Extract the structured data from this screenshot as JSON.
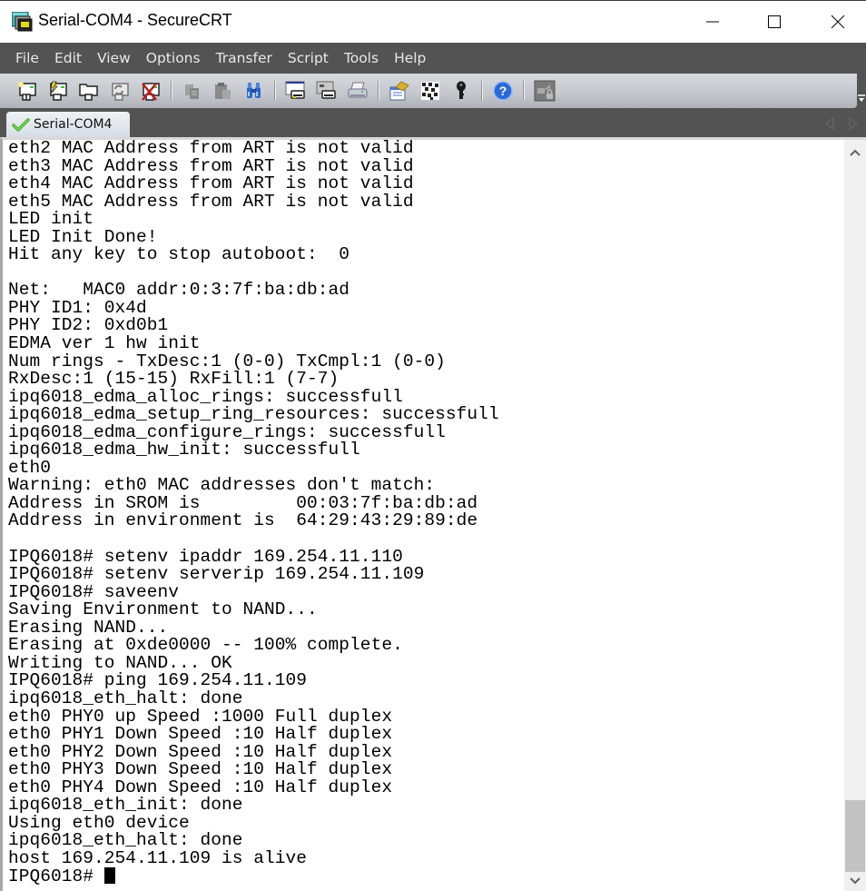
{
  "window": {
    "title": "Serial-COM4 - SecureCRT",
    "controls": {
      "minimize": "minimize",
      "maximize": "maximize",
      "close": "close"
    }
  },
  "menu": {
    "items": [
      {
        "label": "File"
      },
      {
        "label": "Edit"
      },
      {
        "label": "View"
      },
      {
        "label": "Options"
      },
      {
        "label": "Transfer"
      },
      {
        "label": "Script"
      },
      {
        "label": "Tools"
      },
      {
        "label": "Help"
      }
    ]
  },
  "toolbar": {
    "buttons": [
      {
        "icon": "connect-icon",
        "tooltip": "Connect"
      },
      {
        "icon": "quick-connect-icon",
        "tooltip": "Quick Connect"
      },
      {
        "icon": "connect-in-tab-icon",
        "tooltip": "Connect in Tab"
      },
      {
        "icon": "reconnect-icon",
        "tooltip": "Reconnect"
      },
      {
        "icon": "disconnect-icon",
        "tooltip": "Disconnect"
      },
      {
        "icon": "copy-icon",
        "tooltip": "Copy"
      },
      {
        "icon": "paste-icon",
        "tooltip": "Paste"
      },
      {
        "icon": "find-icon",
        "tooltip": "Find"
      },
      {
        "icon": "print-screen-icon",
        "tooltip": "Print Screen"
      },
      {
        "icon": "print-selection-icon",
        "tooltip": "Print Selection"
      },
      {
        "icon": "print-icon",
        "tooltip": "Print"
      },
      {
        "icon": "session-options-icon",
        "tooltip": "Session Options"
      },
      {
        "icon": "keymap-icon",
        "tooltip": "Keymap Editor"
      },
      {
        "icon": "key-icon",
        "tooltip": "Public Key Assistant"
      },
      {
        "icon": "help-icon",
        "tooltip": "Help"
      },
      {
        "icon": "sftp-icon",
        "tooltip": "SecureFX"
      }
    ]
  },
  "tabs": [
    {
      "label": "Serial-COM4",
      "status": "connected",
      "status_color": "#4caf2a"
    }
  ],
  "terminal": {
    "lines": [
      "eth2 MAC Address from ART is not valid",
      "eth3 MAC Address from ART is not valid",
      "eth4 MAC Address from ART is not valid",
      "eth5 MAC Address from ART is not valid",
      "LED init",
      "LED Init Done!",
      "Hit any key to stop autoboot:  0",
      "",
      "Net:   MAC0 addr:0:3:7f:ba:db:ad",
      "PHY ID1: 0x4d",
      "PHY ID2: 0xd0b1",
      "EDMA ver 1 hw init",
      "Num rings - TxDesc:1 (0-0) TxCmpl:1 (0-0)",
      "RxDesc:1 (15-15) RxFill:1 (7-7)",
      "ipq6018_edma_alloc_rings: successfull",
      "ipq6018_edma_setup_ring_resources: successfull",
      "ipq6018_edma_configure_rings: successfull",
      "ipq6018_edma_hw_init: successfull",
      "eth0",
      "Warning: eth0 MAC addresses don't match:",
      "Address in SROM is         00:03:7f:ba:db:ad",
      "Address in environment is  64:29:43:29:89:de",
      "",
      "IPQ6018# setenv ipaddr 169.254.11.110",
      "IPQ6018# setenv serverip 169.254.11.109",
      "IPQ6018# saveenv",
      "Saving Environment to NAND...",
      "Erasing NAND...",
      "Erasing at 0xde0000 -- 100% complete.",
      "Writing to NAND... OK",
      "IPQ6018# ping 169.254.11.109",
      "ipq6018_eth_halt: done",
      "eth0 PHY0 up Speed :1000 Full duplex",
      "eth0 PHY1 Down Speed :10 Half duplex",
      "eth0 PHY2 Down Speed :10 Half duplex",
      "eth0 PHY3 Down Speed :10 Half duplex",
      "eth0 PHY4 Down Speed :10 Half duplex",
      "ipq6018_eth_init: done",
      "Using eth0 device",
      "ipq6018_eth_halt: done",
      "host 169.254.11.109 is alive"
    ],
    "prompt": "IPQ6018# ",
    "scroll_position": 1.0
  }
}
